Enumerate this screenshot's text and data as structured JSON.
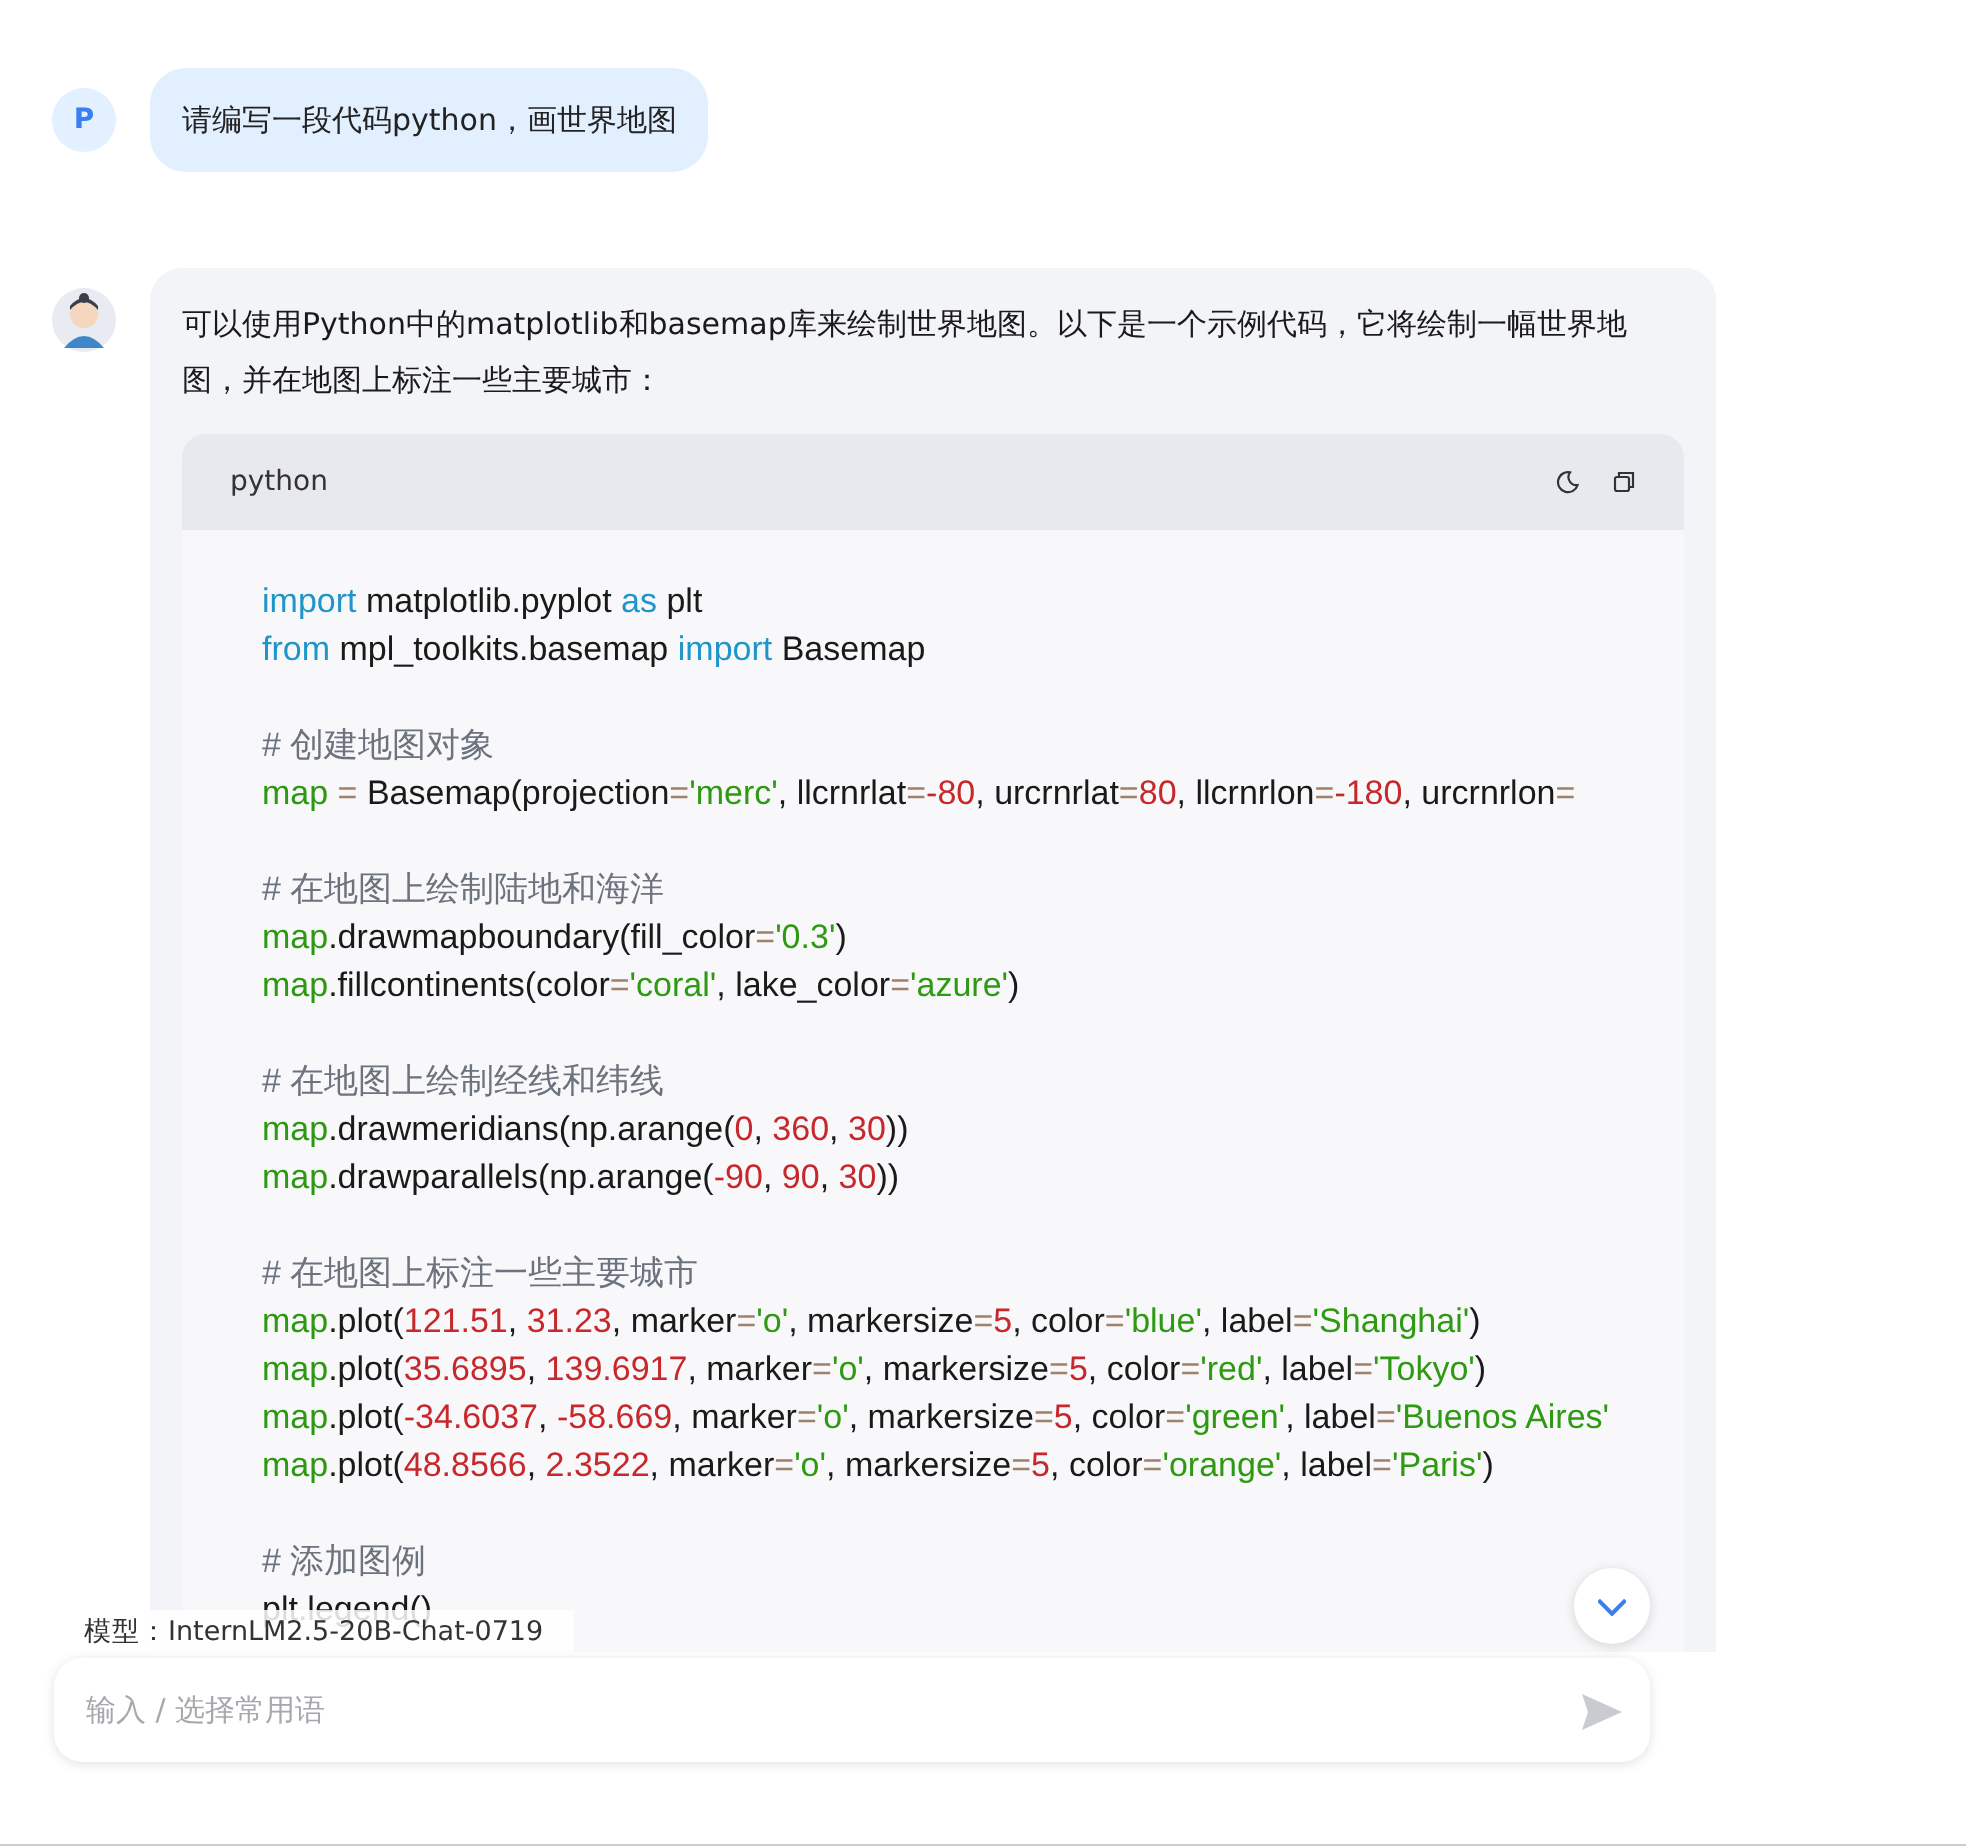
{
  "messages": [
    {
      "kind": "user",
      "avatar_letter": "P",
      "text": "请编写一段代码python，画世界地图"
    },
    {
      "kind": "assistant",
      "text": "可以使用Python中的matplotlib和basemap库来绘制世界地图。以下是一个示例代码，它将绘制一幅世界地图，并在地图上标注一些主要城市：",
      "code": {
        "language": "python",
        "blocks": [
          [
            [
              {
                "kind": "keyword",
                "text": "import"
              },
              {
                "kind": "plain",
                "text": " matplotlib.pyplot "
              },
              {
                "kind": "keyword",
                "text": "as"
              },
              {
                "kind": "plain",
                "text": " plt"
              }
            ],
            [
              {
                "kind": "keyword",
                "text": "from"
              },
              {
                "kind": "plain",
                "text": " mpl_toolkits.basemap "
              },
              {
                "kind": "keyword",
                "text": "import"
              },
              {
                "kind": "plain",
                "text": " Basemap"
              }
            ]
          ],
          [
            [
              {
                "kind": "comment",
                "text": "# 创建地图对象"
              }
            ],
            [
              {
                "kind": "variable",
                "text": "map"
              },
              {
                "kind": "operator",
                "text": " = "
              },
              {
                "kind": "plain",
                "text": "Basemap(projection"
              },
              {
                "kind": "operator",
                "text": "="
              },
              {
                "kind": "string",
                "text": "'merc'"
              },
              {
                "kind": "plain",
                "text": ", llcrnrlat"
              },
              {
                "kind": "operator",
                "text": "="
              },
              {
                "kind": "number",
                "text": "-80"
              },
              {
                "kind": "plain",
                "text": ", urcrnrlat"
              },
              {
                "kind": "operator",
                "text": "="
              },
              {
                "kind": "number",
                "text": "80"
              },
              {
                "kind": "plain",
                "text": ", llcrnrlon"
              },
              {
                "kind": "operator",
                "text": "="
              },
              {
                "kind": "number",
                "text": "-180"
              },
              {
                "kind": "plain",
                "text": ", urcrnrlon"
              },
              {
                "kind": "operator",
                "text": "="
              }
            ]
          ],
          [
            [
              {
                "kind": "comment",
                "text": "# 在地图上绘制陆地和海洋"
              }
            ],
            [
              {
                "kind": "variable",
                "text": "map"
              },
              {
                "kind": "plain",
                "text": ".drawmapboundary(fill_color"
              },
              {
                "kind": "operator",
                "text": "="
              },
              {
                "kind": "string",
                "text": "'0.3'"
              },
              {
                "kind": "plain",
                "text": ")"
              }
            ],
            [
              {
                "kind": "variable",
                "text": "map"
              },
              {
                "kind": "plain",
                "text": ".fillcontinents(color"
              },
              {
                "kind": "operator",
                "text": "="
              },
              {
                "kind": "string",
                "text": "'coral'"
              },
              {
                "kind": "plain",
                "text": ", lake_color"
              },
              {
                "kind": "operator",
                "text": "="
              },
              {
                "kind": "string",
                "text": "'azure'"
              },
              {
                "kind": "plain",
                "text": ")"
              }
            ]
          ],
          [
            [
              {
                "kind": "comment",
                "text": "# 在地图上绘制经线和纬线"
              }
            ],
            [
              {
                "kind": "variable",
                "text": "map"
              },
              {
                "kind": "plain",
                "text": ".drawmeridians(np.arange("
              },
              {
                "kind": "number",
                "text": "0"
              },
              {
                "kind": "plain",
                "text": ", "
              },
              {
                "kind": "number",
                "text": "360"
              },
              {
                "kind": "plain",
                "text": ", "
              },
              {
                "kind": "number",
                "text": "30"
              },
              {
                "kind": "plain",
                "text": "))"
              }
            ],
            [
              {
                "kind": "variable",
                "text": "map"
              },
              {
                "kind": "plain",
                "text": ".drawparallels(np.arange("
              },
              {
                "kind": "number",
                "text": "-90"
              },
              {
                "kind": "plain",
                "text": ", "
              },
              {
                "kind": "number",
                "text": "90"
              },
              {
                "kind": "plain",
                "text": ", "
              },
              {
                "kind": "number",
                "text": "30"
              },
              {
                "kind": "plain",
                "text": "))"
              }
            ]
          ],
          [
            [
              {
                "kind": "comment",
                "text": "# 在地图上标注一些主要城市"
              }
            ],
            [
              {
                "kind": "variable",
                "text": "map"
              },
              {
                "kind": "plain",
                "text": ".plot("
              },
              {
                "kind": "number",
                "text": "121.51"
              },
              {
                "kind": "plain",
                "text": ", "
              },
              {
                "kind": "number",
                "text": "31.23"
              },
              {
                "kind": "plain",
                "text": ", marker"
              },
              {
                "kind": "operator",
                "text": "="
              },
              {
                "kind": "string",
                "text": "'o'"
              },
              {
                "kind": "plain",
                "text": ", markersize"
              },
              {
                "kind": "operator",
                "text": "="
              },
              {
                "kind": "number",
                "text": "5"
              },
              {
                "kind": "plain",
                "text": ", color"
              },
              {
                "kind": "operator",
                "text": "="
              },
              {
                "kind": "string",
                "text": "'blue'"
              },
              {
                "kind": "plain",
                "text": ", label"
              },
              {
                "kind": "operator",
                "text": "="
              },
              {
                "kind": "string",
                "text": "'Shanghai'"
              },
              {
                "kind": "plain",
                "text": ")"
              }
            ],
            [
              {
                "kind": "variable",
                "text": "map"
              },
              {
                "kind": "plain",
                "text": ".plot("
              },
              {
                "kind": "number",
                "text": "35.6895"
              },
              {
                "kind": "plain",
                "text": ", "
              },
              {
                "kind": "number",
                "text": "139.6917"
              },
              {
                "kind": "plain",
                "text": ", marker"
              },
              {
                "kind": "operator",
                "text": "="
              },
              {
                "kind": "string",
                "text": "'o'"
              },
              {
                "kind": "plain",
                "text": ", markersize"
              },
              {
                "kind": "operator",
                "text": "="
              },
              {
                "kind": "number",
                "text": "5"
              },
              {
                "kind": "plain",
                "text": ", color"
              },
              {
                "kind": "operator",
                "text": "="
              },
              {
                "kind": "string",
                "text": "'red'"
              },
              {
                "kind": "plain",
                "text": ", label"
              },
              {
                "kind": "operator",
                "text": "="
              },
              {
                "kind": "string",
                "text": "'Tokyo'"
              },
              {
                "kind": "plain",
                "text": ")"
              }
            ],
            [
              {
                "kind": "variable",
                "text": "map"
              },
              {
                "kind": "plain",
                "text": ".plot("
              },
              {
                "kind": "number",
                "text": "-34.6037"
              },
              {
                "kind": "plain",
                "text": ", "
              },
              {
                "kind": "number",
                "text": "-58.669"
              },
              {
                "kind": "plain",
                "text": ", marker"
              },
              {
                "kind": "operator",
                "text": "="
              },
              {
                "kind": "string",
                "text": "'o'"
              },
              {
                "kind": "plain",
                "text": ", markersize"
              },
              {
                "kind": "operator",
                "text": "="
              },
              {
                "kind": "number",
                "text": "5"
              },
              {
                "kind": "plain",
                "text": ", color"
              },
              {
                "kind": "operator",
                "text": "="
              },
              {
                "kind": "string",
                "text": "'green'"
              },
              {
                "kind": "plain",
                "text": ", label"
              },
              {
                "kind": "operator",
                "text": "="
              },
              {
                "kind": "string",
                "text": "'Buenos Aires'"
              }
            ],
            [
              {
                "kind": "variable",
                "text": "map"
              },
              {
                "kind": "plain",
                "text": ".plot("
              },
              {
                "kind": "number",
                "text": "48.8566"
              },
              {
                "kind": "plain",
                "text": ", "
              },
              {
                "kind": "number",
                "text": "2.3522"
              },
              {
                "kind": "plain",
                "text": ", marker"
              },
              {
                "kind": "operator",
                "text": "="
              },
              {
                "kind": "string",
                "text": "'o'"
              },
              {
                "kind": "plain",
                "text": ", markersize"
              },
              {
                "kind": "operator",
                "text": "="
              },
              {
                "kind": "number",
                "text": "5"
              },
              {
                "kind": "plain",
                "text": ", color"
              },
              {
                "kind": "operator",
                "text": "="
              },
              {
                "kind": "string",
                "text": "'orange'"
              },
              {
                "kind": "plain",
                "text": ", label"
              },
              {
                "kind": "operator",
                "text": "="
              },
              {
                "kind": "string",
                "text": "'Paris'"
              },
              {
                "kind": "plain",
                "text": ")"
              }
            ]
          ],
          [
            [
              {
                "kind": "comment",
                "text": "# 添加图例"
              }
            ],
            [
              {
                "kind": "plain",
                "text": "plt.legend()"
              }
            ]
          ]
        ]
      }
    }
  ],
  "model_label": "模型：InternLM2.5-20B-Chat-0719",
  "input": {
    "placeholder": "输入 / 选择常用语"
  }
}
